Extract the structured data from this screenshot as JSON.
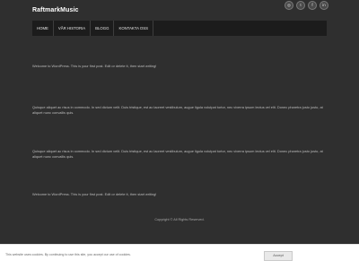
{
  "site": {
    "title": "RaftmarkMusic"
  },
  "social": [
    {
      "icon": "camera-icon",
      "glyph": "◎"
    },
    {
      "icon": "twitter-icon",
      "glyph": "t"
    },
    {
      "icon": "facebook-icon",
      "glyph": "f"
    },
    {
      "icon": "linkedin-icon",
      "glyph": "in"
    }
  ],
  "nav": {
    "items": [
      {
        "label": "HOME"
      },
      {
        "label": "VÅR HISTORIA"
      },
      {
        "label": "BLOGG"
      },
      {
        "label": "KONTAKTA OSS"
      }
    ]
  },
  "posts": [
    {
      "text": "Welcome to WordPress. This is your first post. Edit or delete it, then start writing!"
    },
    {
      "text": "Quisque aliquet ac risus in commodo. In sed dictum velit. Duis tristique, est ac laoreet vestibulum, augue ligula volutpat tortor, nec viverra ipsum lectus vel elit. Donec pharetra justo justo, at aliquet nunc convallis quis."
    },
    {
      "text": "Quisque aliquet ac risus in commodo. In sed dictum velit. Duis tristique, est ac laoreet vestibulum, augue ligula volutpat tortor, nec viverra ipsum lectus vel elit. Donec pharetra justo justo, at aliquet nunc convallis quis."
    },
    {
      "text": "Welcome to WordPress. This is your first post. Edit or delete it, then start writing!"
    }
  ],
  "footer": {
    "copyright": "Copyright © All Rights Reserved."
  },
  "cookie": {
    "text": "This website uses cookies. By continuing to use this site, you accept our use of cookies.",
    "accept_label": "Accept"
  }
}
